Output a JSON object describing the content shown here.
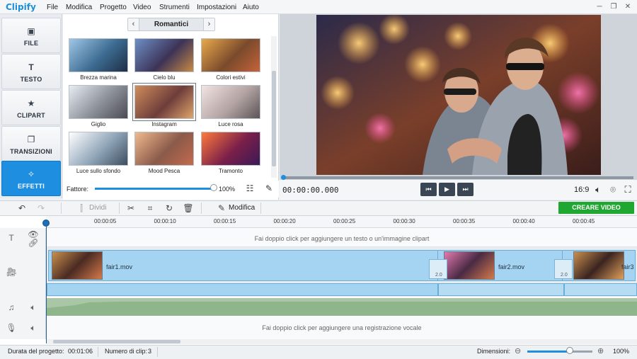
{
  "app": {
    "title": "Clipify"
  },
  "menu": [
    "File",
    "Modifica",
    "Progetto",
    "Video",
    "Strumenti",
    "Impostazioni",
    "Aiuto"
  ],
  "sidebar": {
    "items": [
      {
        "label": "FILE",
        "icon": "image-icon",
        "glyph": "▣"
      },
      {
        "label": "TESTO",
        "icon": "text-icon",
        "glyph": "T"
      },
      {
        "label": "CLIPART",
        "icon": "star-icon",
        "glyph": "★"
      },
      {
        "label": "TRANSIZIONI",
        "icon": "transitions-icon",
        "glyph": "❐"
      },
      {
        "label": "EFFETTI",
        "icon": "effects-icon",
        "glyph": "✧",
        "active": true
      }
    ]
  },
  "effects": {
    "category": "Romantici",
    "items": [
      {
        "label": "Brezza marina",
        "tone": "linear-gradient(135deg,#9fc6e6,#3d6b91 55%,#1e2e44)"
      },
      {
        "label": "Cielo blu",
        "tone": "linear-gradient(135deg,#6d8fc7,#3d3357 55%,#c78a44)"
      },
      {
        "label": "Colori estivi",
        "tone": "linear-gradient(135deg,#e8a94a,#7a4a2c 55%,#c6633a)"
      },
      {
        "label": "Giglio",
        "tone": "linear-gradient(135deg,#e8edf4,#8a8f98 55%,#4b4a52)"
      },
      {
        "label": "Instagram",
        "tone": "linear-gradient(135deg,#cf8d5b,#6e3d3b 55%,#e0a66b)"
      },
      {
        "label": "Luce rosa",
        "tone": "linear-gradient(135deg,#f1e4e3,#b3a4a3 55%,#5b5456)"
      },
      {
        "label": "Luce sullo sfondo",
        "tone": "linear-gradient(135deg,#ffffff,#8fa5b8 55%,#3d4d5e)"
      },
      {
        "label": "Mood Pesca",
        "tone": "linear-gradient(135deg,#f0b98d,#8a5a4a 55%,#c46b4d)"
      },
      {
        "label": "Tramonto",
        "tone": "linear-gradient(135deg,#ff7a3a,#7a1f4a 55%,#3b1a55)"
      }
    ],
    "selected_index": 4,
    "factor": {
      "label": "Fattore:",
      "value": "100%",
      "level": 1.0
    }
  },
  "player": {
    "timecode": "00:00:00.000",
    "aspect": "16:9",
    "progress": 0.0
  },
  "toolbar": {
    "split_label": "Dividi",
    "edit_label": "Modifica",
    "create_label": "CREARE VIDEO"
  },
  "timeline": {
    "ticks": [
      "00:00:05",
      "00:00:10",
      "00:00:15",
      "00:00:20",
      "00:00:25",
      "00:00:30",
      "00:00:35",
      "00:00:40",
      "00:00:45"
    ],
    "text_hint": "Fai doppio click per aggiungere un testo o un'immagine clipart",
    "voice_hint": "Fai doppio click per aggiungere una registrazione vocale",
    "clips": [
      "fair1.mov",
      "fair2.mov",
      "fair3"
    ],
    "transitions": [
      "2.0",
      "2.0"
    ]
  },
  "status": {
    "duration_label": "Durata del progetto:",
    "duration": "00:01:06",
    "clips_label": "Numero di clip:",
    "clips_count": "3",
    "size_label": "Dimensioni:",
    "zoom": "100%",
    "zoom_level": 0.65
  },
  "colors": {
    "accent": "#1e8fe0",
    "create": "#1fa732"
  }
}
